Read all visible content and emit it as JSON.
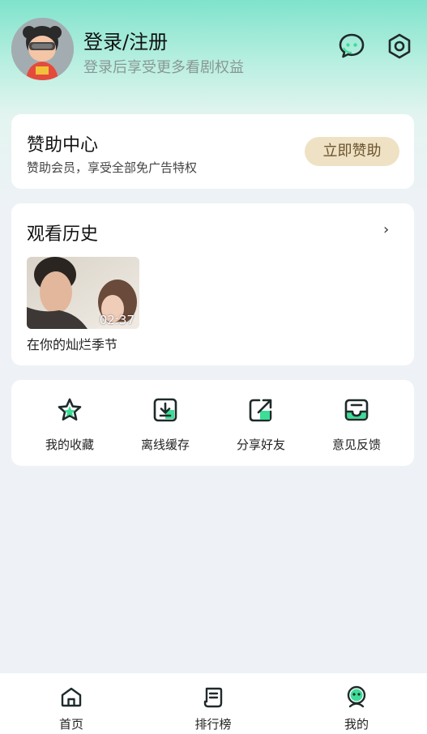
{
  "header": {
    "login_title": "登录/注册",
    "login_subtitle": "登录后享受更多看剧权益",
    "message_icon": "chat-bubble-icon",
    "settings_icon": "settings-hexagon-icon"
  },
  "sponsor": {
    "title": "赞助中心",
    "subtitle": "赞助会员，享受全部免广告特权",
    "button_label": "立即赞助"
  },
  "history": {
    "title": "观看历史",
    "arrow": "›",
    "items": [
      {
        "title": "在你的灿烂季节",
        "duration": "02:37"
      }
    ]
  },
  "actions": [
    {
      "label": "我的收藏",
      "icon": "star-icon"
    },
    {
      "label": "离线缓存",
      "icon": "download-icon"
    },
    {
      "label": "分享好友",
      "icon": "share-icon"
    },
    {
      "label": "意见反馈",
      "icon": "feedback-inbox-icon"
    }
  ],
  "tabbar": [
    {
      "label": "首页",
      "icon": "home-icon"
    },
    {
      "label": "排行榜",
      "icon": "ranking-icon"
    },
    {
      "label": "我的",
      "icon": "profile-mascot-icon"
    }
  ],
  "colors": {
    "accent_green": "#3ddc97",
    "header_teal": "#7fe3cc",
    "sponsor_button_bg": "#efe1c3",
    "page_bg": "#eef2f6"
  }
}
